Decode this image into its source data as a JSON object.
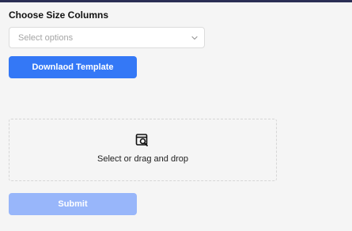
{
  "form": {
    "size_columns_label": "Choose Size Columns",
    "select_placeholder": "Select options",
    "download_button": "Downlaod Template",
    "dropzone_text": "Select or drag and drop",
    "submit_button": "Submit"
  },
  "colors": {
    "primary": "#3478f6",
    "primary_disabled": "#98b6fa",
    "background": "#f5f5f5",
    "top_bar": "#2b2f55"
  },
  "icons": {
    "select_chevron": "chevron-down-icon",
    "dropzone": "file-search-icon"
  }
}
